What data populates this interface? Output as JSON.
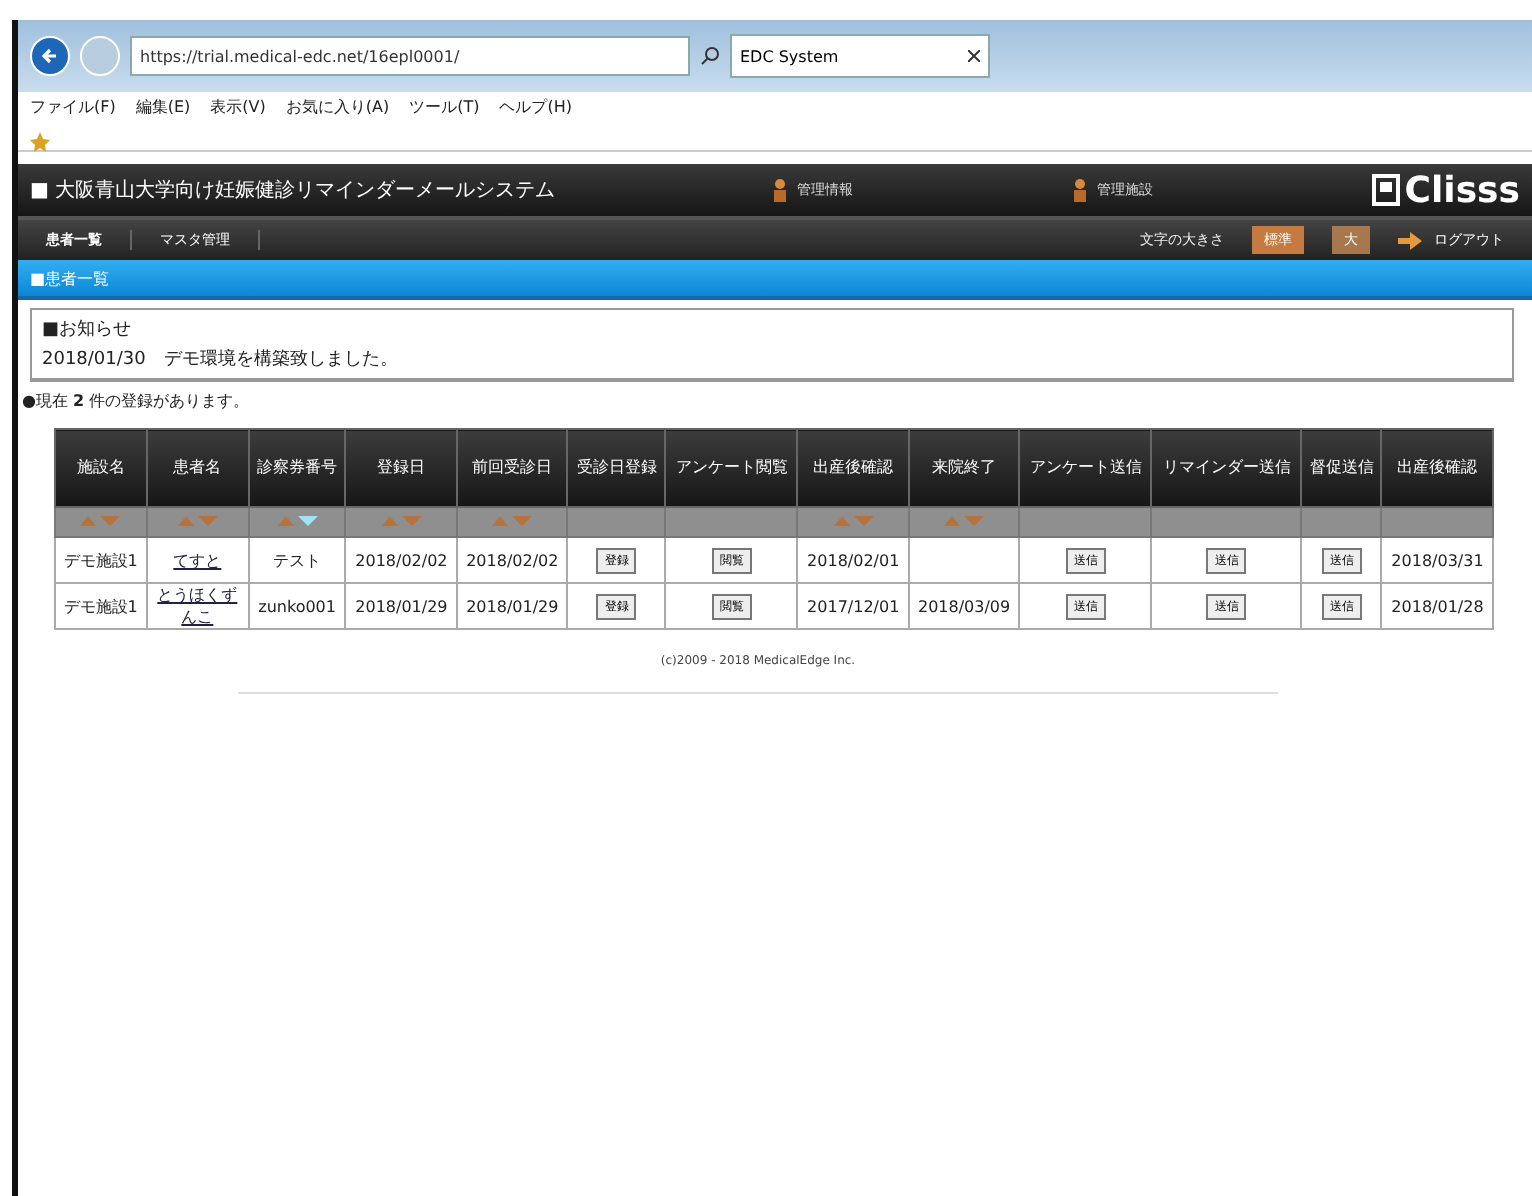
{
  "browser": {
    "url": "https://trial.medical-edc.net/16epl0001/",
    "tab_title": "EDC System",
    "menu": [
      "ファイル(F)",
      "編集(E)",
      "表示(V)",
      "お気に入り(A)",
      "ツール(T)",
      "ヘルプ(H)"
    ]
  },
  "header": {
    "title": "■ 大阪青山大学向け妊娠健診リマインダーメールシステム",
    "links": [
      "管理情報",
      "管理施設"
    ],
    "logo": "Clisss"
  },
  "nav": {
    "items": [
      {
        "label": "患者一覧",
        "selected": true
      },
      {
        "label": "マスタ管理",
        "selected": false
      }
    ],
    "font_size_label": "文字の大きさ",
    "font_sizes": [
      {
        "label": "標準",
        "selected": true
      },
      {
        "label": "大",
        "selected": false
      }
    ],
    "logout": "ログアウト"
  },
  "section_title": "■患者一覧",
  "notice": {
    "title": "■お知らせ",
    "items": [
      "2018/01/30　デモ環境を構築致しました。"
    ]
  },
  "count_text": "●現在 **2** 件の登録があります。",
  "table": {
    "columns": [
      {
        "label": "施設名",
        "sortable": true,
        "sorted": false
      },
      {
        "label": "患者名",
        "sortable": true,
        "sorted": false
      },
      {
        "label": "診察券番号",
        "sortable": true,
        "sorted": true
      },
      {
        "label": "登録日",
        "sortable": true,
        "sorted": false
      },
      {
        "label": "前回受診日",
        "sortable": true,
        "sorted": false
      },
      {
        "label": "受診日登録",
        "sortable": false
      },
      {
        "label": "アンケート閲覧",
        "sortable": false
      },
      {
        "label": "出産後確認",
        "sortable": true,
        "sorted": false
      },
      {
        "label": "来院終了",
        "sortable": true,
        "sorted": false
      },
      {
        "label": "アンケート送信",
        "sortable": false
      },
      {
        "label": "リマインダー送信",
        "sortable": false
      },
      {
        "label": "督促送信",
        "sortable": false
      },
      {
        "label": "出産後確認",
        "sortable": false
      }
    ],
    "rows": [
      [
        {
          "kind": "text",
          "text": "デモ施設1"
        },
        {
          "kind": "link",
          "text": "てすと"
        },
        {
          "kind": "text",
          "text": "テスト"
        },
        {
          "kind": "text",
          "text": "2018/02/02"
        },
        {
          "kind": "text",
          "text": "2018/02/02"
        },
        {
          "kind": "button",
          "text": "登録"
        },
        {
          "kind": "button",
          "text": "閲覧"
        },
        {
          "kind": "text",
          "text": "2018/02/01"
        },
        {
          "kind": "text",
          "text": ""
        },
        {
          "kind": "button",
          "text": "送信"
        },
        {
          "kind": "button",
          "text": "送信"
        },
        {
          "kind": "button",
          "text": "送信"
        },
        {
          "kind": "text",
          "text": "2018/03/31"
        }
      ],
      [
        {
          "kind": "text",
          "text": "デモ施設1"
        },
        {
          "kind": "link",
          "text": "とうほくずんこ"
        },
        {
          "kind": "text",
          "text": "zunko001"
        },
        {
          "kind": "text",
          "text": "2018/01/29"
        },
        {
          "kind": "text",
          "text": "2018/01/29"
        },
        {
          "kind": "button",
          "text": "登録"
        },
        {
          "kind": "button",
          "text": "閲覧"
        },
        {
          "kind": "text",
          "text": "2017/12/01"
        },
        {
          "kind": "text",
          "text": "2018/03/09"
        },
        {
          "kind": "button",
          "text": "送信"
        },
        {
          "kind": "button",
          "text": "送信"
        },
        {
          "kind": "button",
          "text": "送信"
        },
        {
          "kind": "text",
          "text": "2018/01/28"
        }
      ]
    ]
  },
  "footer": "(c)2009 - 2018 MedicalEdge Inc."
}
